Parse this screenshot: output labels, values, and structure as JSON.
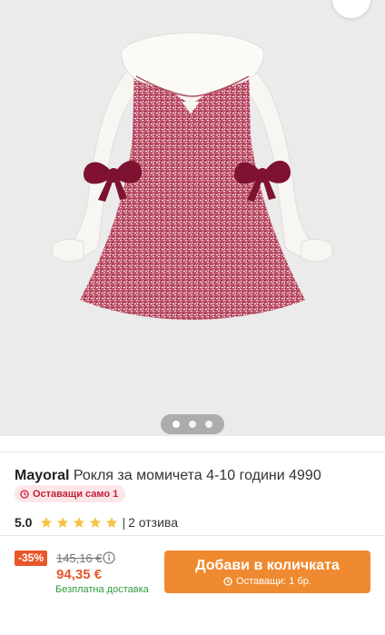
{
  "product": {
    "brand": "Mayoral",
    "name": "Рокля за момичета 4-10 години 4990",
    "stock_badge": "Оставащи само 1",
    "rating": "5.0",
    "stars": 5,
    "reviews_sep": "|",
    "reviews": "2 отзива"
  },
  "gallery": {
    "images_count": 3,
    "active_index": 0
  },
  "purchase": {
    "discount": "-35%",
    "old_price": "145,16 €",
    "new_price": "94,35 €",
    "delivery": "Безплатна доставка",
    "add_to_cart": "Добави в количката",
    "remaining": "Оставащи: 1 бр."
  },
  "colors": {
    "accent_orange": "#ef8a30",
    "price_orange": "#e8562a",
    "stock_red": "#c4203b",
    "delivery_green": "#2e9b3e",
    "star_yellow": "#f6c445"
  },
  "icons": [
    "share-icon",
    "clock-icon",
    "star-icon",
    "info-icon"
  ]
}
